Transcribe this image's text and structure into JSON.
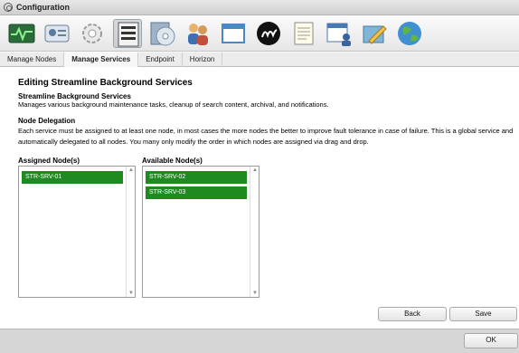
{
  "window": {
    "title": "Configuration"
  },
  "toolbar": {
    "icons": [
      "monitor-icon",
      "id-card-icon",
      "gear-icon",
      "server-icon",
      "cd-install-icon",
      "users-icon",
      "window-icon",
      "logo-icon",
      "notepad-icon",
      "calendar-user-icon",
      "edit-pencil-icon",
      "globe-icon"
    ]
  },
  "tabs": [
    "Manage Nodes",
    "Manage Services",
    "Endpoint",
    "Horizon"
  ],
  "active_tab": "Manage Services",
  "page": {
    "heading": "Editing Streamline Background Services",
    "service_name": "Streamline Background Services",
    "service_desc": "Manages various background maintenance tasks, cleanup of search content, archival, and notifications.",
    "delegation_heading": "Node Delegation",
    "delegation_text": "Each service must be assigned to at least one node, in most cases the more nodes the better to improve fault tolerance in case of failure. This is a global service and automatically delegated to all nodes. You many only modify the order in which nodes are assigned via drag and drop."
  },
  "lists": {
    "assigned_label": "Assigned Node(s)",
    "available_label": "Available Node(s)",
    "assigned": [
      "STR-SRV-01"
    ],
    "available": [
      "STR-SRV-02",
      "STR-SRV-03"
    ]
  },
  "buttons": {
    "back": "Back",
    "save": "Save",
    "ok": "OK"
  },
  "colors": {
    "node_item": "#1f8a1f"
  }
}
